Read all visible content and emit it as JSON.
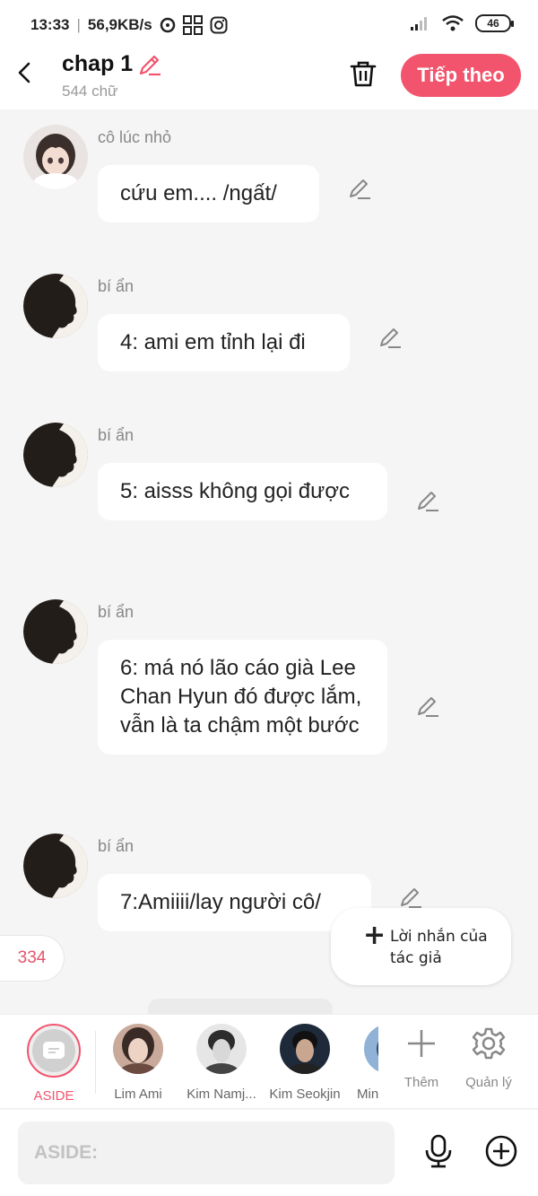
{
  "status_bar": {
    "time": "13:33",
    "network_speed": "56,9KB/s",
    "battery": "46"
  },
  "header": {
    "title": "chap 1",
    "word_count": "544 chữ",
    "next_label": "Tiếp theo"
  },
  "messages": [
    {
      "name": "cô lúc nhỏ",
      "text": "cứu em.... /ngất/"
    },
    {
      "name": "bí ẩn",
      "text": "4: ami em tỉnh lại đi"
    },
    {
      "name": "bí ẩn",
      "text": "5: aisss không gọi được"
    },
    {
      "name": "bí ẩn",
      "text": "6: má nó lão cáo già Lee Chan Hyun đó được lắm, vẫn là ta chậm một bước"
    },
    {
      "name": "bí ẩn",
      "text": "7:Amiiii/lay người cô/"
    }
  ],
  "count_badge": "334",
  "author_note": {
    "label": "Lời nhắn của tác giả"
  },
  "characters": [
    {
      "label": "ASIDE"
    },
    {
      "label": "Lim Ami"
    },
    {
      "label": "Kim Namj..."
    },
    {
      "label": "Kim Seokjin"
    },
    {
      "label": "Min"
    }
  ],
  "tools": {
    "add_label": "Thêm",
    "manage_label": "Quản lý"
  },
  "input": {
    "placeholder": "ASIDE:"
  },
  "colors": {
    "accent": "#f2546d",
    "background": "#f5f5f5",
    "bubble": "#ffffff"
  }
}
